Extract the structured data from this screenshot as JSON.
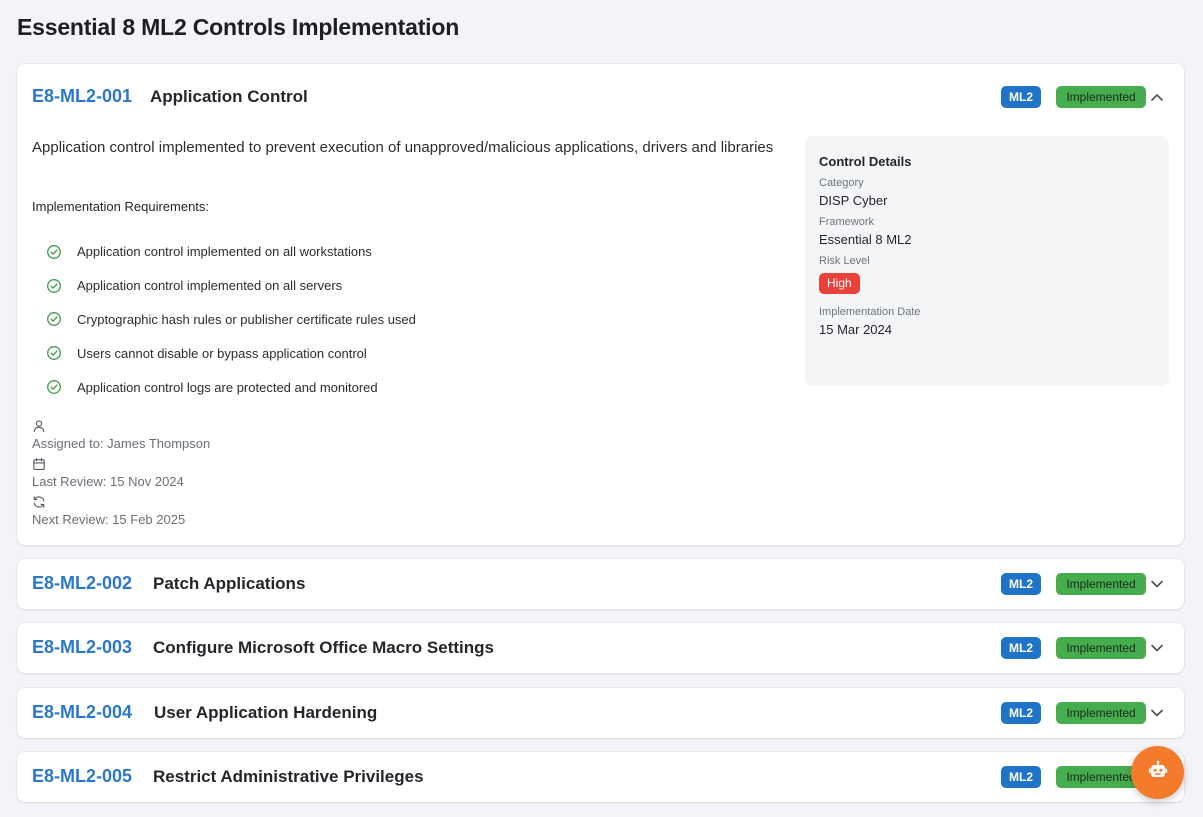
{
  "page": {
    "title": "Essential 8 ML2 Controls Implementation"
  },
  "controls": [
    {
      "id": "E8-ML2-001",
      "name": "Application Control",
      "level": "ML2",
      "status": "Implemented",
      "expanded": true,
      "description": "Application control implemented to prevent execution of unapproved/malicious applications, drivers and libraries",
      "requirements_title": "Implementation Requirements:",
      "requirements": [
        "Application control implemented on all workstations",
        "Application control implemented on all servers",
        "Cryptographic hash rules or publisher certificate rules used",
        "Users cannot disable or bypass application control",
        "Application control logs are protected and monitored"
      ],
      "assigned": "Assigned to: James Thompson",
      "last_review": "Last Review: 15 Nov 2024",
      "next_review": "Next Review: 15 Feb 2025",
      "details": {
        "title": "Control Details",
        "category_label": "Category",
        "category": "DISP Cyber",
        "framework_label": "Framework",
        "framework": "Essential 8 ML2",
        "risk_label": "Risk Level",
        "risk": "High",
        "date_label": "Implementation Date",
        "date": "15 Mar 2024"
      }
    },
    {
      "id": "E8-ML2-002",
      "name": "Patch Applications",
      "level": "ML2",
      "status": "Implemented",
      "expanded": false
    },
    {
      "id": "E8-ML2-003",
      "name": "Configure Microsoft Office Macro Settings",
      "level": "ML2",
      "status": "Implemented",
      "expanded": false
    },
    {
      "id": "E8-ML2-004",
      "name": "User Application Hardening",
      "level": "ML2",
      "status": "Implemented",
      "expanded": false
    },
    {
      "id": "E8-ML2-005",
      "name": "Restrict Administrative Privileges",
      "level": "ML2",
      "status": "Implemented",
      "expanded": false
    }
  ],
  "colors": {
    "accent": "#2b78c9",
    "ml_badge": "#1f74c7",
    "status_badge": "#46ad4f",
    "risk_high": "#e8423a",
    "fab": "#f47a2c"
  },
  "icons": {
    "requirement": "check-circle-icon",
    "assigned": "user-icon",
    "last_review": "calendar-icon",
    "next_review": "refresh-icon",
    "expanded": "chevron-up-icon",
    "collapsed": "chevron-down-icon",
    "fab": "robot-icon"
  }
}
